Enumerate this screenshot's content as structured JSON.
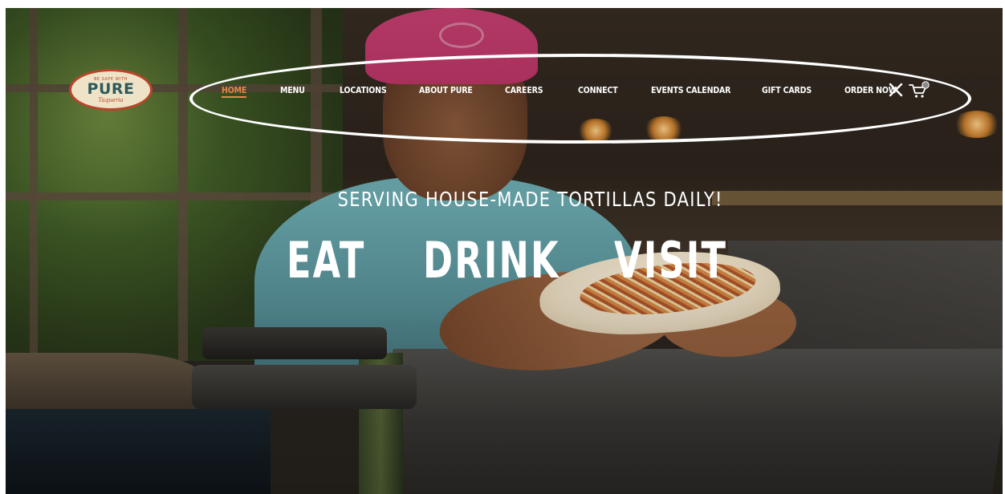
{
  "brand": {
    "tagline_small": "BE SAFE WITH",
    "name": "PURE",
    "sub": "Taqueria"
  },
  "nav": {
    "items": [
      {
        "label": "HOME",
        "active": true
      },
      {
        "label": "MENU",
        "active": false
      },
      {
        "label": "LOCATIONS",
        "active": false
      },
      {
        "label": "ABOUT PURE",
        "active": false
      },
      {
        "label": "CAREERS",
        "active": false
      },
      {
        "label": "CONNECT",
        "active": false
      },
      {
        "label": "EVENTS CALENDAR",
        "active": false
      },
      {
        "label": "GIFT CARDS",
        "active": false
      },
      {
        "label": "ORDER NOW",
        "active": false
      }
    ],
    "icons": {
      "close": "close-icon",
      "cart": "cart-icon"
    },
    "active_color": "#e6884a"
  },
  "hero": {
    "tagline": "SERVING HOUSE-MADE TORTILLAS DAILY!",
    "words": [
      "EAT",
      "DRINK",
      "VISIT"
    ]
  },
  "colors": {
    "logo_red": "#b8462a",
    "logo_teal": "#2e5b5b",
    "logo_cream": "#efe3c7",
    "text": "#ffffff"
  }
}
